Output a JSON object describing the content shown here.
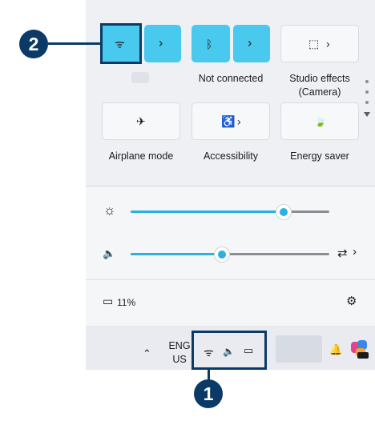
{
  "callouts": {
    "one": "1",
    "two": "2"
  },
  "quick_settings": {
    "wifi": {
      "glyph": "ᯤ",
      "icon": "wifi-icon",
      "chevron": "›",
      "caption": ""
    },
    "bluetooth": {
      "glyph": "ᛒ",
      "chevron": "›",
      "caption": "Not connected"
    },
    "studio_effects": {
      "glyph": "⬚",
      "chevron": "›",
      "caption_line1": "Studio effects",
      "caption_line2": "(Camera)"
    },
    "airplane": {
      "glyph": "✈",
      "caption": "Airplane mode"
    },
    "accessibility": {
      "glyph": "♿",
      "chevron": "›",
      "caption": "Accessibility"
    },
    "energy_saver": {
      "glyph": "🍃",
      "caption": "Energy saver"
    }
  },
  "sliders": {
    "brightness": {
      "glyph": "☼",
      "level_percent": 77
    },
    "volume": {
      "glyph": "🔈",
      "level_percent": 46,
      "output_glyph": "⇄",
      "output_chevron": "›"
    }
  },
  "battery": {
    "glyph": "▭",
    "percent_label": "11%"
  },
  "settings_glyph": "⚙",
  "taskbar": {
    "overflow_glyph": "⌃",
    "language_line1": "ENG",
    "language_line2": "US",
    "wifi_glyph": "ᯤ",
    "volume_glyph": "🔈",
    "battery_glyph": "▭",
    "bell_glyph": "🔔"
  },
  "colors": {
    "accent": "#49c9ed",
    "callout": "#0b3a66",
    "slider_fill": "#2ab0e1"
  }
}
